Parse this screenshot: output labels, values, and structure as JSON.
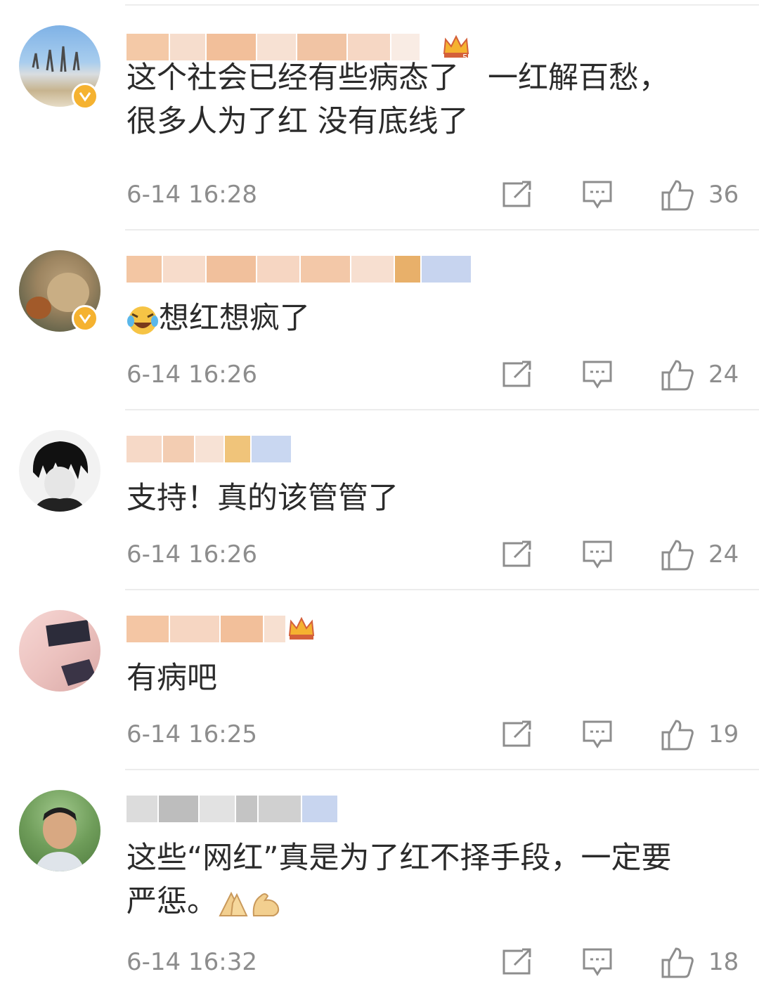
{
  "comments": [
    {
      "text_lines": [
        "这个社会已经有些病态了   一红解百愁，",
        "很多人为了红 没有底线了"
      ],
      "time": "6-14 16:28",
      "likes": "36",
      "verified": true,
      "crown": true
    },
    {
      "text": "想红想疯了",
      "leading_emoji": "laughing-crying-emoji",
      "time": "6-14 16:26",
      "likes": "24",
      "verified": true,
      "crown": false
    },
    {
      "text": "支持！真的该管管了",
      "time": "6-14 16:26",
      "likes": "24",
      "verified": false,
      "crown": false
    },
    {
      "text": "有病吧",
      "time": "6-14 16:25",
      "likes": "19",
      "verified": false,
      "crown": true
    },
    {
      "text_lines": [
        "这些“网红”真是为了红不择手段，一定要",
        "严惩。"
      ],
      "trailing_emojis": [
        "praying-hands-emoji",
        "flexed-biceps-emoji"
      ],
      "time": "6-14 16:32",
      "likes": "18",
      "verified": false,
      "crown": false
    }
  ],
  "icons": {
    "share": "share-icon",
    "reply": "comment-icon",
    "like": "thumbs-up-icon"
  },
  "colors": {
    "text": "#2b2b2b",
    "meta": "#8d8d8d",
    "badge": "#f5b230",
    "divider": "#ececec"
  }
}
